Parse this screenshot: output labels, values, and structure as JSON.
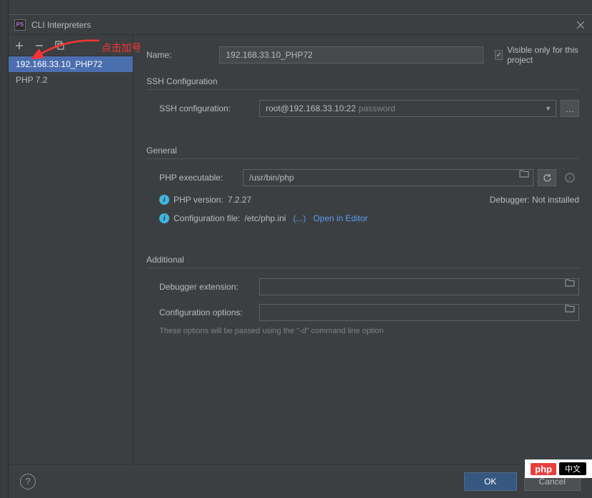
{
  "title": "CLI Interpreters",
  "annotation": "点击加号",
  "sidebar": {
    "items": [
      {
        "label": "192.168.33.10_PHP72",
        "selected": true
      },
      {
        "label": "PHP 7.2",
        "selected": false
      }
    ]
  },
  "form": {
    "name_label": "Name:",
    "name_value": "192.168.33.10_PHP72",
    "visible_only_label": "Visible only for this project",
    "sections": {
      "ssh": {
        "title": "SSH Configuration",
        "config_label": "SSH configuration:",
        "config_value": "root@192.168.33.10:22",
        "config_placeholder": "password"
      },
      "general": {
        "title": "General",
        "executable_label": "PHP executable:",
        "executable_value": "/usr/bin/php",
        "php_version_label": "PHP version:",
        "php_version_value": "7.2.27",
        "debugger_label": "Debugger:",
        "debugger_value": "Not installed",
        "config_file_label": "Configuration file:",
        "config_file_value": "/etc/php.ini",
        "ellipsis": "(...)",
        "open_editor": "Open in Editor"
      },
      "additional": {
        "title": "Additional",
        "debugger_ext_label": "Debugger extension:",
        "config_opts_label": "Configuration options:",
        "hint": "These options will be passed using the \"-d\" command line option"
      }
    }
  },
  "footer": {
    "ok": "OK",
    "cancel": "Cancel"
  },
  "watermark": {
    "logo": "php",
    "cn": "中文"
  }
}
